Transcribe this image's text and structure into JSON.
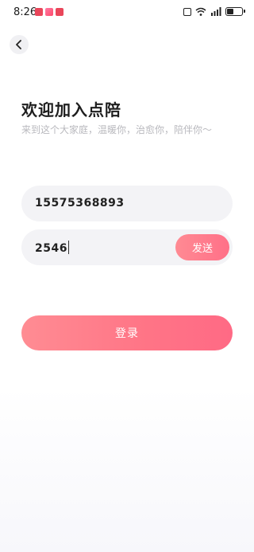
{
  "status_bar": {
    "time": "8:26",
    "battery_level": 0.5,
    "notification_icons": [
      "app-notification-icon",
      "app-notification-icon",
      "app-notification-icon"
    ]
  },
  "nav": {
    "back_icon": "chevron-left-icon"
  },
  "header": {
    "title": "欢迎加入点陪",
    "subtitle": "来到这个大家庭，温暖你，治愈你，陪伴你～"
  },
  "form": {
    "phone_value": "15575368893",
    "code_value": "2546",
    "send_label": "发送",
    "login_label": "登录"
  },
  "colors": {
    "accent": "#ff7a8a",
    "title": "#1e1e1e",
    "subtitle": "#b9b9be",
    "field_bg": "#f3f3f6"
  }
}
